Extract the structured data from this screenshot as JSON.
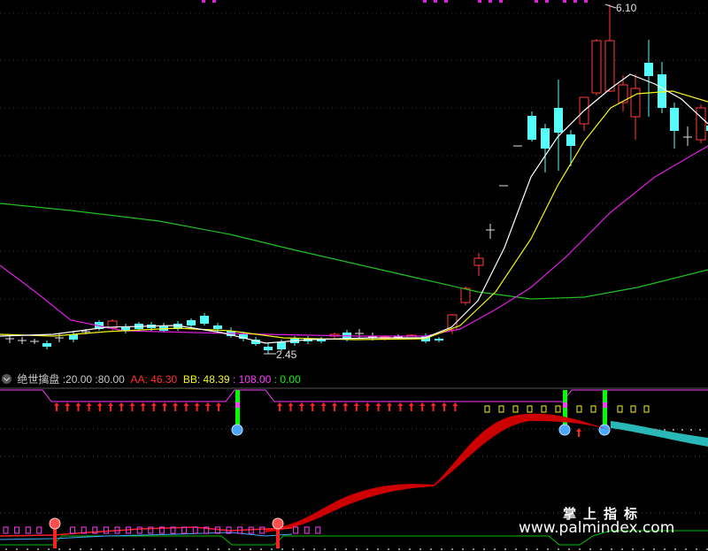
{
  "price_chart": {
    "high_label": "6.10",
    "low_label": "2.45",
    "colors": {
      "up": "#ff3b3b",
      "down": "#54fcfc",
      "ma_white": "#ffffff",
      "ma_yellow": "#f5f516",
      "ma_magenta": "#e01ee0",
      "ma_green": "#22c022"
    }
  },
  "indicator": {
    "name": "绝世擒盘",
    "param1": "20.00",
    "param2": "80.00",
    "aa_label": "AA:",
    "aa_value": "46.30",
    "bb_label": "BB:",
    "bb_value": "48.39",
    "v3_value": "108.00",
    "v4_value": "0.00",
    "colors": {
      "aa": "#ff3030",
      "bb": "#f5f516",
      "v3": "#ff3cff",
      "v4": "#00ff00",
      "band_red": "#cc0000",
      "band_cyan": "#2ab7b7"
    }
  },
  "watermark": {
    "cn": "掌上指标",
    "url": "www.palmindex.com"
  }
}
